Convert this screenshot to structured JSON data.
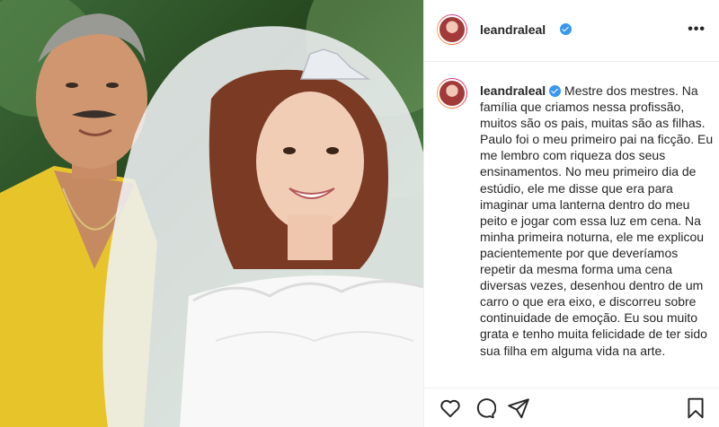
{
  "post": {
    "username": "leandraleal",
    "verified": true,
    "caption_user": "leandraleal",
    "caption_text": "Mestre dos mestres. Na família que criamos nessa profissão, muitos são os pais, muitas são as filhas. Paulo foi o meu primeiro pai na ficção. Eu me lembro com riqueza dos seus ensinamentos. No meu primeiro dia de estúdio, ele me disse que era para imaginar uma lanterna dentro do meu peito e jogar com essa luz em cena. Na minha primeira noturna, ele me explicou pacientemente por que deveríamos repetir da mesma forma uma cena diversas vezes, desenhou dentro de um carro o que era eixo, e discorreu sobre continuidade de emoção. Eu sou muito grata e tenho muita felicidade de ter sido sua filha em alguma vida na arte."
  },
  "header": {
    "more_label": "•••"
  },
  "actions": {
    "icons": [
      "heart-icon",
      "comment-icon",
      "share-icon",
      "bookmark-icon"
    ]
  },
  "colors": {
    "verified": "#3897f0",
    "text": "#262626",
    "divider": "#efefef"
  }
}
